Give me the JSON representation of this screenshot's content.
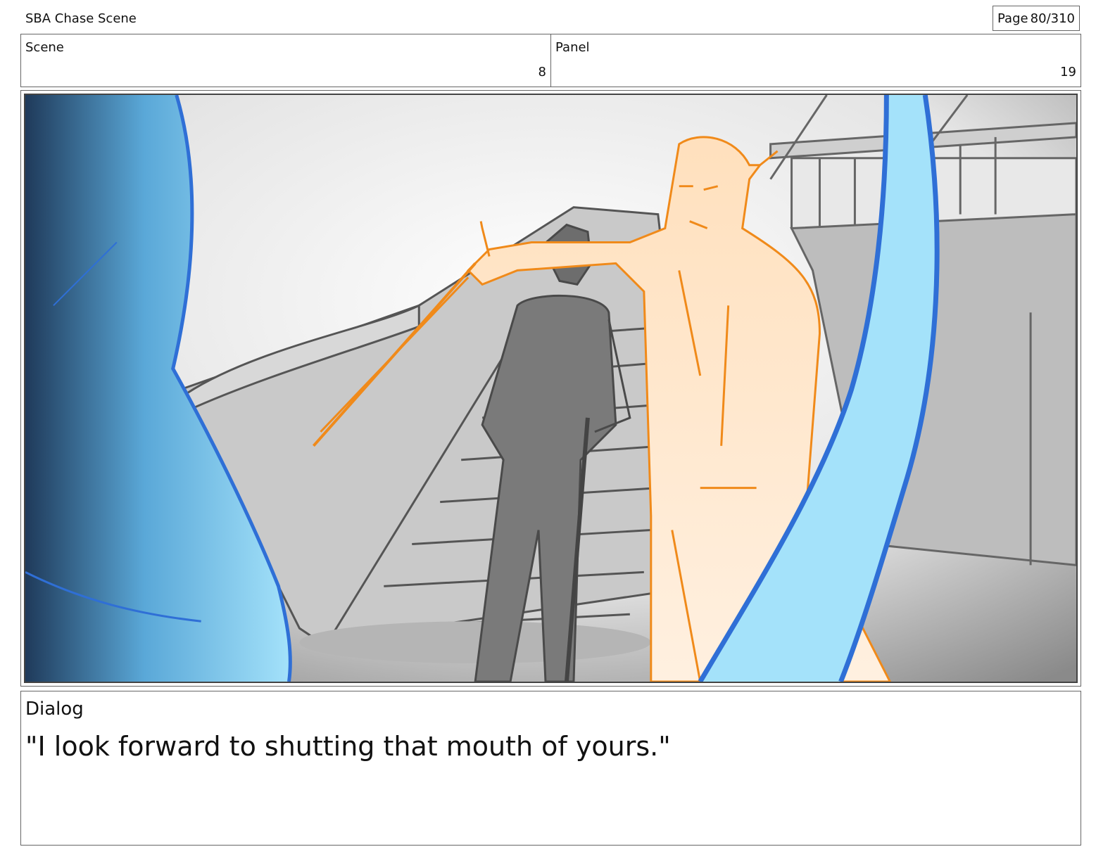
{
  "document": {
    "title": "SBA Chase Scene",
    "page_label": "Page",
    "page_value": "80/310"
  },
  "info": {
    "scene_label": "Scene",
    "scene_value": "8",
    "panel_label": "Panel",
    "panel_value": "19"
  },
  "frame": {
    "description_icon": "storyboard-drawing",
    "colors": {
      "foreground_blue": "#9fdcf5",
      "outline_blue": "#2f6fd6",
      "orange_figure": "#ffe2c4",
      "orange_line": "#f08a1a",
      "gray_figure": "#777777",
      "background": "#d9d9d9"
    }
  },
  "dialog": {
    "label": "Dialog",
    "text": "\"I look forward to shutting that mouth of yours.\""
  }
}
